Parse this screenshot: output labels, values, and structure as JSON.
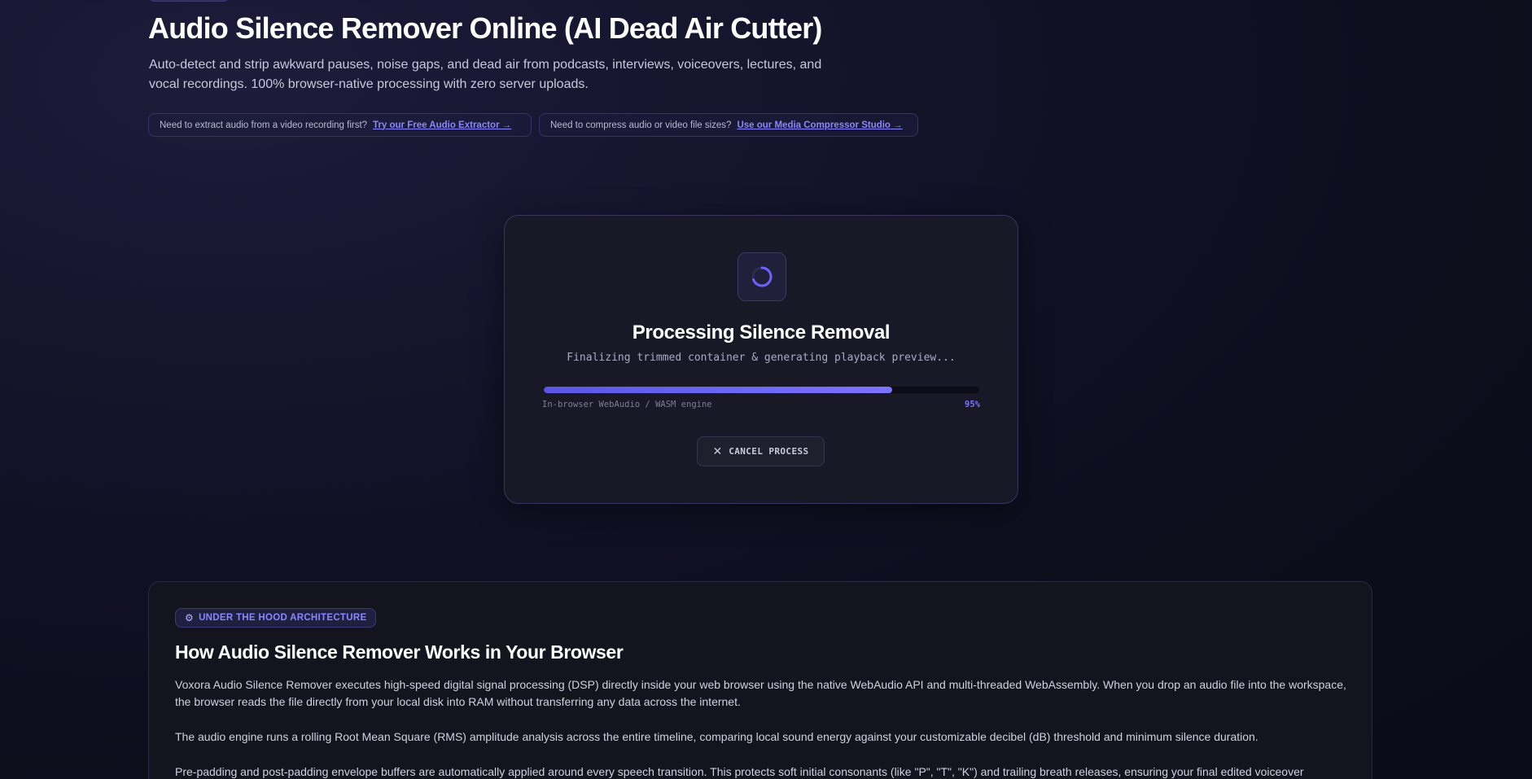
{
  "header": {
    "title": "Audio Silence Remover Online (AI Dead Air Cutter)",
    "subtitle": "Auto-detect and strip awkward pauses, noise gaps, and dead air from podcasts, interviews, voiceovers, lectures, and vocal recordings. 100% browser-native processing with zero server uploads."
  },
  "hints": [
    {
      "text": "Need to extract audio from a video recording first?",
      "link": "Try our Free Audio Extractor →"
    },
    {
      "text": "Need to compress audio or video file sizes?",
      "link": "Use our Media Compressor Studio →"
    }
  ],
  "processing": {
    "icon": "spinner-icon",
    "title": "Processing Silence Removal",
    "status": "Finalizing trimmed container & generating playback preview...",
    "engine": "In-browser WebAudio / WASM engine",
    "progress_percent": 95,
    "progress_label": "95%",
    "cancel_label": "CANCEL PROCESS",
    "accent_color": "#6c63ff"
  },
  "info": {
    "badge": "UNDER THE HOOD ARCHITECTURE",
    "title": "How Audio Silence Remover Works in Your Browser",
    "paragraphs": [
      "Voxora Audio Silence Remover executes high-speed digital signal processing (DSP) directly inside your web browser using the native WebAudio API and multi-threaded WebAssembly. When you drop an audio file into the workspace, the browser reads the file directly from your local disk into RAM without transferring any data across the internet.",
      "The audio engine runs a rolling Root Mean Square (RMS) amplitude analysis across the entire timeline, comparing local sound energy against your customizable decibel (dB) threshold and minimum silence duration.",
      "Pre-padding and post-padding envelope buffers are automatically applied around every speech transition. This protects soft initial consonants (like \"P\", \"T\", \"K\") and trailing breath releases, ensuring your final edited voiceover"
    ]
  }
}
